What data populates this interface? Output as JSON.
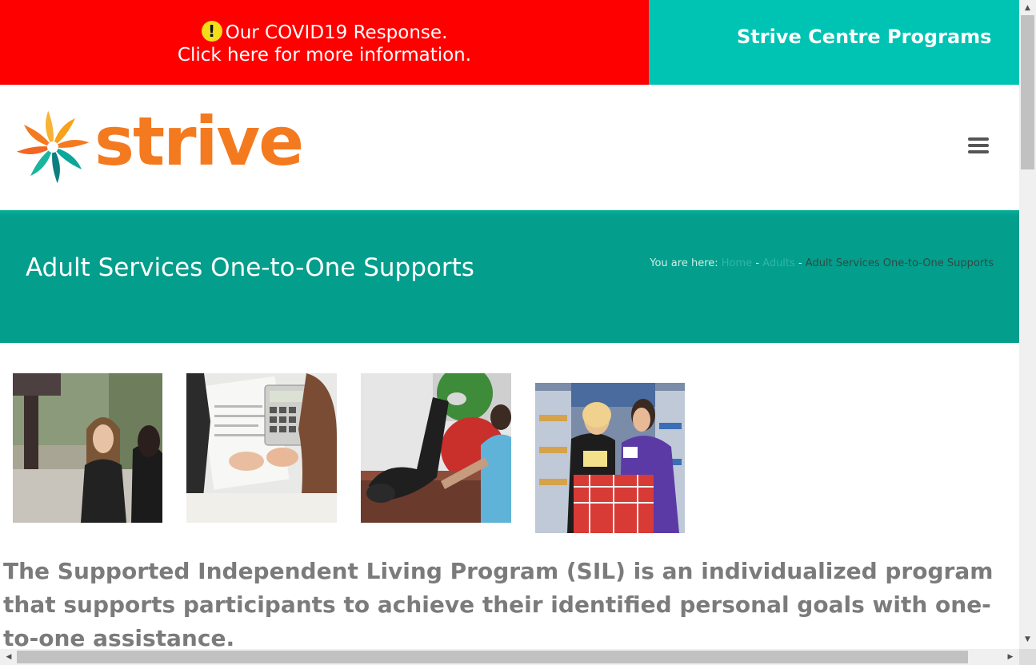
{
  "covid": {
    "icon": "exclamation-icon",
    "line1": "Our COVID19 Response.",
    "line2": "Click here for more information.",
    "color": "#ff0000"
  },
  "programs": {
    "label": "Strive Centre Programs",
    "color": "#00c4b3"
  },
  "header": {
    "logo_text": "strive",
    "logo_color": "#f47a20",
    "menu_icon": "hamburger-menu-icon"
  },
  "title_band": {
    "title": "Adult Services One-to-One Supports",
    "breadcrumb": {
      "prefix": "You are here:",
      "items": [
        "Home",
        "Adults",
        "Adult Services One-to-One Supports"
      ],
      "separator": "-"
    },
    "color": "#039e8c"
  },
  "photos": [
    {
      "name": "two-women-talking-photo"
    },
    {
      "name": "calculator-budgeting-photo"
    },
    {
      "name": "exercise-ball-therapy-photo"
    },
    {
      "name": "grocery-shopping-photo"
    }
  ],
  "intro": {
    "text": "The Supported Independent Living Program (SIL)  is an individualized program that supports participants to achieve their identified personal goals with one-to-one assistance."
  },
  "scrollbars": {
    "up_arrow": "▲",
    "down_arrow": "▼",
    "left_arrow": "◀",
    "right_arrow": "▶"
  }
}
